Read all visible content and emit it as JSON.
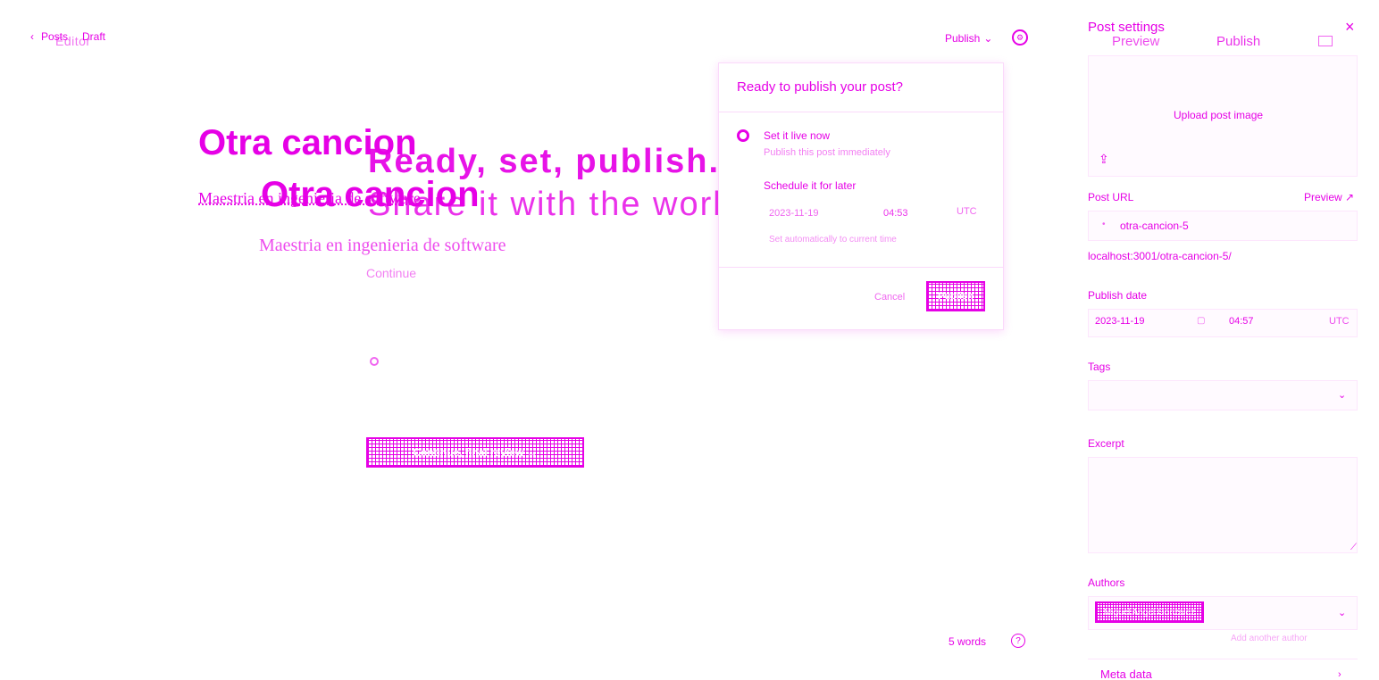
{
  "breadcrumb": {
    "posts_label": "Posts",
    "separator": "",
    "status_label": "Draft",
    "ghost_label": "Editor"
  },
  "toolbar": {
    "publish_label": "Publish",
    "publish_chevron": "⌄",
    "settings_icon": "gear-icon"
  },
  "editor": {
    "title": "Otra cancion",
    "subtitle": "Maestria en ingenieria de software",
    "ghost_heading_1": "Ready, set, publish.",
    "ghost_heading_2": "Share it with the world",
    "ghost_title_2": "Otra cancion",
    "ghost_subtitle_2": "Maestria en ingenieria de software",
    "ghost_small": "Continue",
    "continue_button": "Continue, final review →",
    "word_count": "5 words",
    "help_icon": "?"
  },
  "publish_popover": {
    "heading": "Ready to publish your post?",
    "option_now_label": "Set it live now",
    "option_now_sub": "Publish this post immediately",
    "option_later_label": "Schedule it for later",
    "date": "2023-11-19",
    "time": "04:53",
    "timezone": "UTC",
    "note": "Set automatically to current time",
    "cancel_label": "Cancel",
    "publish_label": "Publish"
  },
  "settings_panel": {
    "title": "Post settings",
    "ghost_preview": "Preview",
    "ghost_publish": "Publish",
    "close_icon": "×",
    "upload_label": "Upload post image",
    "upload_icon": "⇪",
    "post_url_label": "Post URL",
    "preview_link": "Preview ↗",
    "slug": "otra-cancion-5",
    "full_url": "localhost:3001/otra-cancion-5/",
    "publish_date_label": "Publish date",
    "publish_date": "2023-11-19",
    "publish_time": "04:57",
    "publish_tz": "UTC",
    "tags_label": "Tags",
    "excerpt_label": "Excerpt",
    "authors_label": "Authors",
    "author_chip": "Miguel Angel Gonzalez",
    "author_ghost": "Add another author",
    "meta_label": "Meta data"
  },
  "colors": {
    "accent": "#e600e6",
    "background": "#ffffff"
  }
}
